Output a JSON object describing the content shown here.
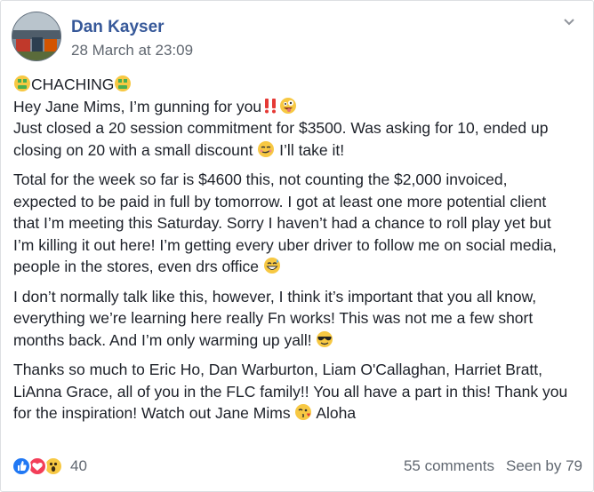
{
  "post": {
    "author": "Dan Kayser",
    "timestamp": "28 March at 23:09",
    "paragraphs": [
      {
        "lines": [
          {
            "pre_emoji": "money-mouth-emoji",
            "text": "CHACHING",
            "post_emoji": "money-mouth-emoji"
          },
          {
            "text": "Hey Jane Mims, I’m gunning for you",
            "post_emoji": "double-exclamation-emoji",
            "post_emoji2": "crazy-face-emoji"
          },
          {
            "text": "Just closed a 20 session commitment for $3500. Was asking for 10, ended up closing on 20 with a small discount ",
            "mid_emoji": "smirk-emoji",
            "tail": " I’ll take it!"
          }
        ]
      },
      {
        "text": "Total for the week so far is $4600 this, not counting the $2,000 invoiced, expected to be paid in full by tomorrow. I got at least one more potential client that I’m meeting this Saturday. Sorry I haven’t had a chance to roll play yet but I’m killing it out here! I’m getting every uber driver to follow me on social media, people in the stores, even drs office ",
        "emoji": "grin-sweat-emoji"
      },
      {
        "text": "I don’t normally talk like this, however, I think it’s important that you all know, everything we’re learning here really Fn works! This was not me a few short months back. And I’m only warming up yall! ",
        "emoji": "sunglasses-emoji"
      },
      {
        "text": "Thanks so much to Eric Ho, Dan Warburton, Liam O'Callaghan, Harriet Bratt, LiAnna Grace, all of you in the FLC family!! You all have a part in this! Thank you for the inspiration! Watch out Jane Mims ",
        "emoji": "kiss-wink-emoji",
        "tail": " Aloha"
      }
    ]
  },
  "footer": {
    "reaction_count": "40",
    "comments": "55 comments",
    "seen_by": "Seen by 79",
    "reactions": [
      "like",
      "love",
      "wow"
    ]
  },
  "colors": {
    "link": "#365899",
    "meta": "#606770",
    "text": "#1d2129",
    "like": "#2078f4",
    "love": "#f33e58"
  }
}
